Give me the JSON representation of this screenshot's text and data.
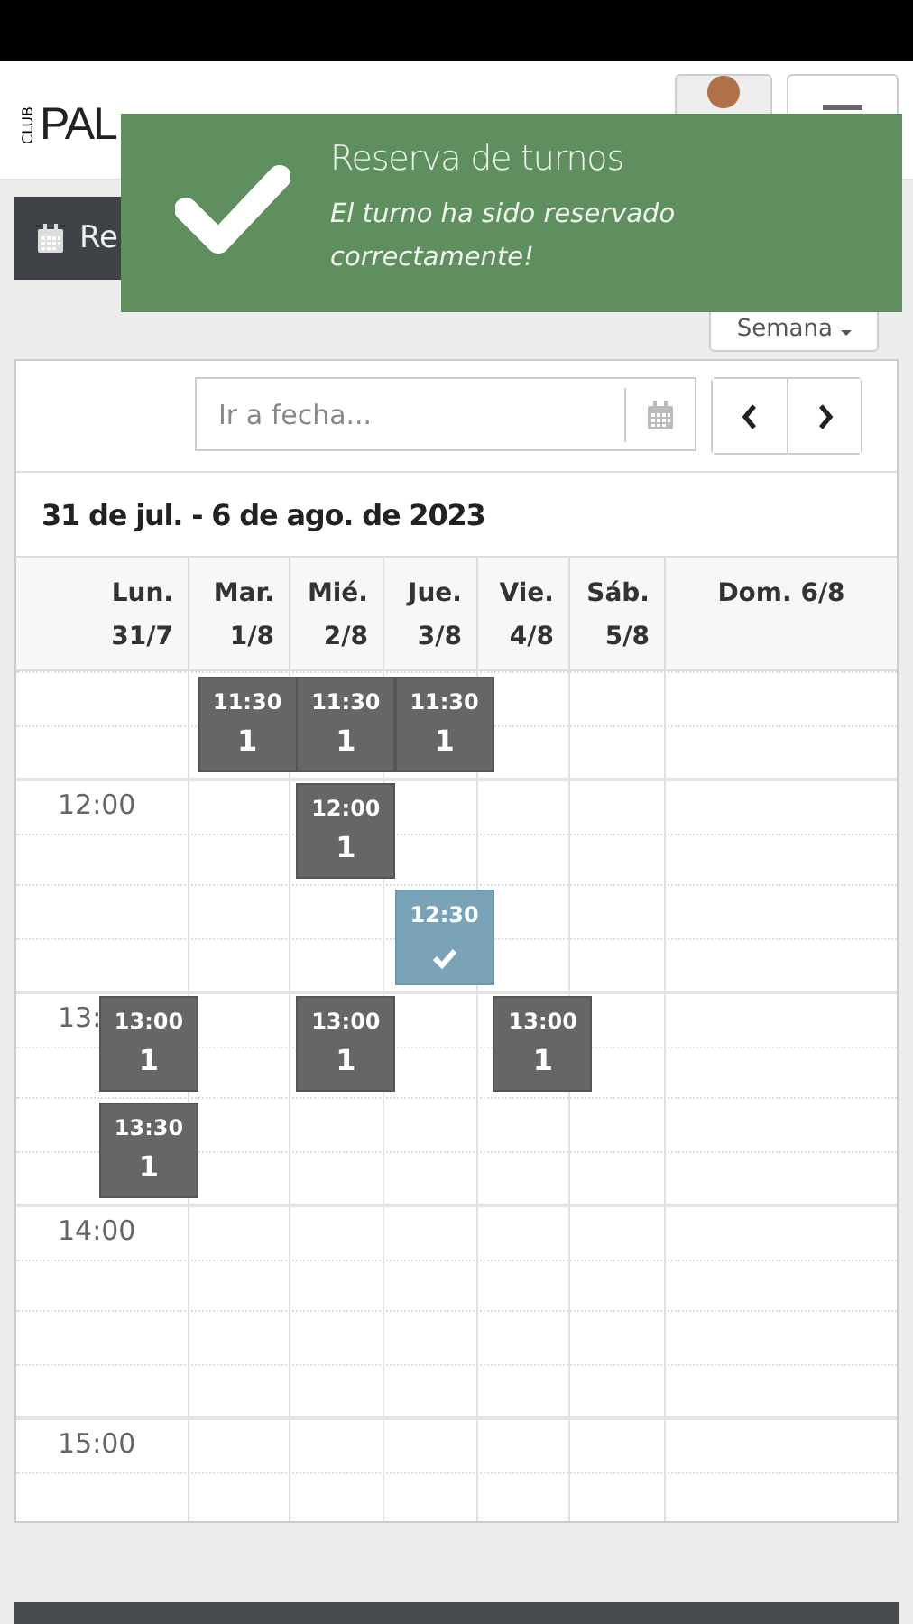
{
  "header": {
    "logo_small": "CLUB",
    "logo": "PAL"
  },
  "toolbar_button": {
    "label": "Re"
  },
  "view_select": {
    "label": "Semana"
  },
  "calendar": {
    "date_field": {
      "placeholder": "Ir a fecha..."
    },
    "range_title": "31 de jul. - 6 de ago. de 2023",
    "days": [
      {
        "label": "Lun.",
        "date": "31/7",
        "events": [
          {
            "time": "13:00",
            "count": "1",
            "booked": false
          },
          {
            "time": "13:30",
            "count": "1",
            "booked": false
          }
        ]
      },
      {
        "label": "Mar.",
        "date": "1/8",
        "events": [
          {
            "time": "11:30",
            "count": "1",
            "booked": false
          }
        ]
      },
      {
        "label": "Mié.",
        "date": "2/8",
        "events": [
          {
            "time": "11:30",
            "count": "1",
            "booked": false
          },
          {
            "time": "12:00",
            "count": "1",
            "booked": false
          },
          {
            "time": "13:00",
            "count": "1",
            "booked": false
          }
        ]
      },
      {
        "label": "Jue.",
        "date": "3/8",
        "events": [
          {
            "time": "11:30",
            "count": "1",
            "booked": false
          },
          {
            "time": "12:30",
            "booked": true
          }
        ]
      },
      {
        "label": "Vie.",
        "date": "4/8",
        "events": [
          {
            "time": "13:00",
            "count": "1",
            "booked": false
          }
        ]
      },
      {
        "label": "Sáb.",
        "date": "5/8"
      },
      {
        "label": "Dom. 6/8"
      }
    ],
    "time_labels": [
      "12:00",
      "13:",
      "14:00",
      "15:00"
    ]
  },
  "toast": {
    "title": "Reserva de turnos",
    "message": "El turno ha sido reservado correctamente!"
  }
}
